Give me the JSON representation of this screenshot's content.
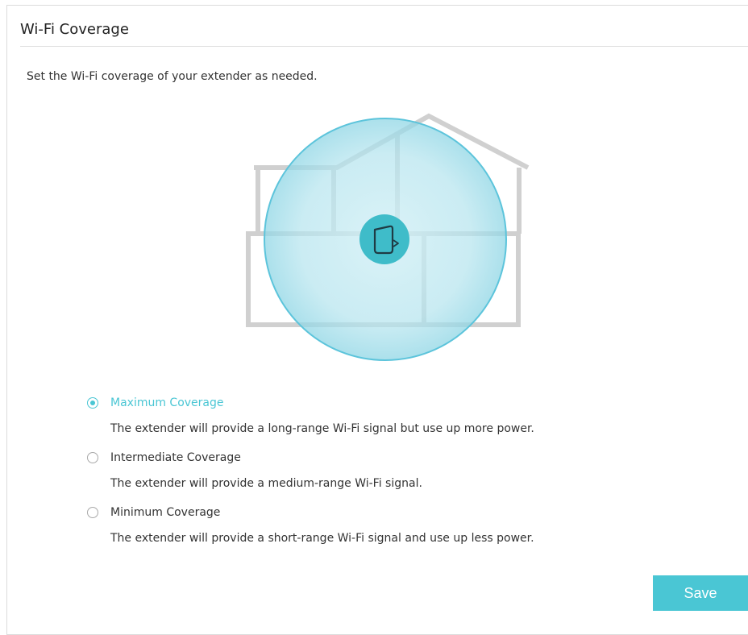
{
  "panel": {
    "title": "Wi-Fi Coverage",
    "intro": "Set the Wi-Fi coverage of your extender as needed."
  },
  "illustration": {
    "icons": [
      "house-outline-icon",
      "coverage-circle-icon",
      "extender-icon"
    ],
    "accent_color": "#4ac6d4"
  },
  "coverage_options": [
    {
      "label": "Maximum Coverage",
      "description": "The extender will provide a long-range Wi-Fi signal but use up more power.",
      "selected": true
    },
    {
      "label": "Intermediate Coverage",
      "description": "The extender will provide a medium-range Wi-Fi signal.",
      "selected": false
    },
    {
      "label": "Minimum Coverage",
      "description": "The extender will provide a short-range Wi-Fi signal and use up less power.",
      "selected": false
    }
  ],
  "actions": {
    "save_label": "Save"
  },
  "colors": {
    "accent": "#4ac6d4",
    "border": "#dcdcdc",
    "text": "#333333"
  }
}
